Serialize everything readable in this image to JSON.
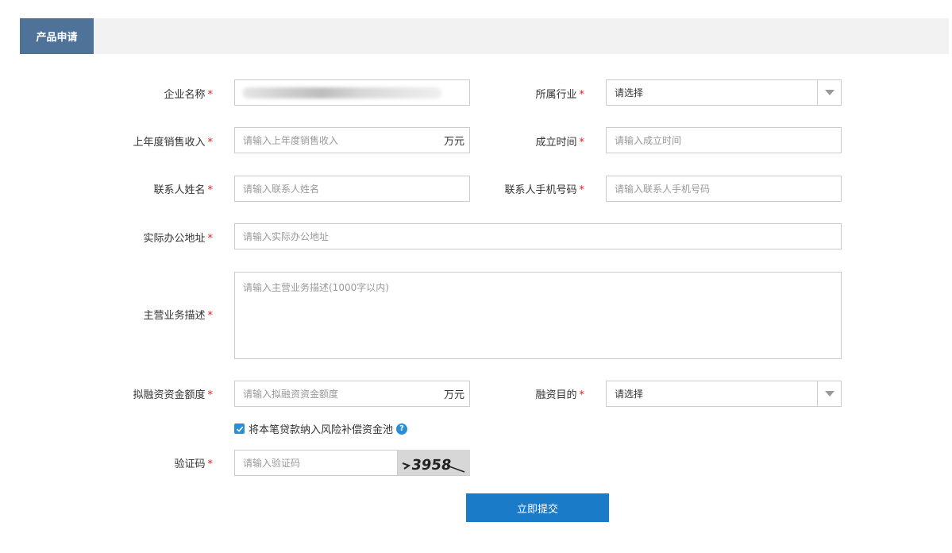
{
  "tab": {
    "label": "产品申请"
  },
  "form": {
    "company_name": {
      "label": "企业名称",
      "value": ""
    },
    "industry": {
      "label": "所属行业",
      "value": "请选择"
    },
    "last_year_revenue": {
      "label": "上年度销售收入",
      "placeholder": "请输入上年度销售收入",
      "unit": "万元"
    },
    "founded_time": {
      "label": "成立时间",
      "placeholder": "请输入成立时间"
    },
    "contact_name": {
      "label": "联系人姓名",
      "placeholder": "请输入联系人姓名"
    },
    "contact_phone": {
      "label": "联系人手机号码",
      "placeholder": "请输入联系人手机号码"
    },
    "office_address": {
      "label": "实际办公地址",
      "placeholder": "请输入实际办公地址"
    },
    "business_desc": {
      "label": "主营业务描述",
      "placeholder": "请输入主营业务描述(1000字以内)"
    },
    "financing_amount": {
      "label": "拟融资资金额度",
      "placeholder": "请输入拟融资资金额度",
      "unit": "万元"
    },
    "financing_purpose": {
      "label": "融资目的",
      "value": "请选择"
    },
    "risk_pool_checkbox": {
      "label": "将本笔贷款纳入风险补偿资金池",
      "checked": true
    },
    "captcha": {
      "label": "验证码",
      "placeholder": "请输入验证码",
      "image_text": "3958"
    },
    "required_mark": "*",
    "submit_label": "立即提交"
  },
  "icons": {
    "dropdown": "chevron-down-icon",
    "help": "question-circle-icon",
    "check": "check-icon"
  },
  "colors": {
    "tab_bg": "#4f7298",
    "accent": "#1a7bc9",
    "required": "#e02020",
    "border": "#cccccc"
  }
}
